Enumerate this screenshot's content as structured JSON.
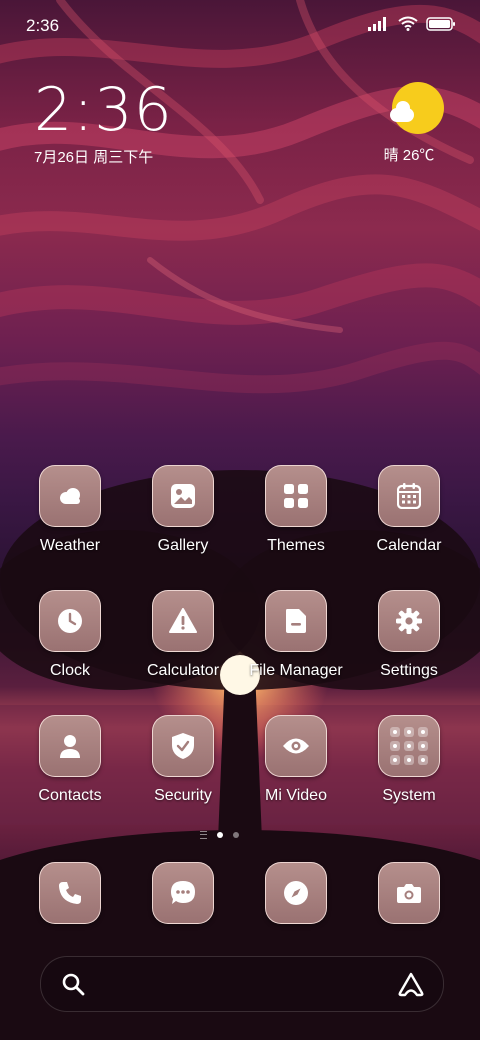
{
  "status_bar": {
    "time": "2:36"
  },
  "clock_widget": {
    "time": "2:36",
    "date": "7月26日 周三下午"
  },
  "weather_widget": {
    "summary": "晴 26℃"
  },
  "apps": [
    {
      "label": "Weather",
      "icon": "cloud-icon"
    },
    {
      "label": "Gallery",
      "icon": "image-icon"
    },
    {
      "label": "Themes",
      "icon": "grid-icon"
    },
    {
      "label": "Calendar",
      "icon": "calendar-icon"
    },
    {
      "label": "Clock",
      "icon": "clock-icon"
    },
    {
      "label": "Calculator",
      "icon": "warning-icon"
    },
    {
      "label": "File Manager",
      "icon": "folder-icon"
    },
    {
      "label": "Settings",
      "icon": "gear-icon"
    },
    {
      "label": "Contacts",
      "icon": "person-icon"
    },
    {
      "label": "Security",
      "icon": "shield-icon"
    },
    {
      "label": "Mi Video",
      "icon": "eye-icon"
    },
    {
      "label": "System",
      "icon": "folder-grid-icon"
    }
  ],
  "dock": [
    {
      "icon": "phone-icon"
    },
    {
      "icon": "message-icon"
    },
    {
      "icon": "compass-icon"
    },
    {
      "icon": "camera-icon"
    }
  ],
  "page_indicator": {
    "pages": 2,
    "current": 1
  },
  "colors": {
    "tile": "#a57f7d",
    "sun": "#f7cc1c"
  }
}
